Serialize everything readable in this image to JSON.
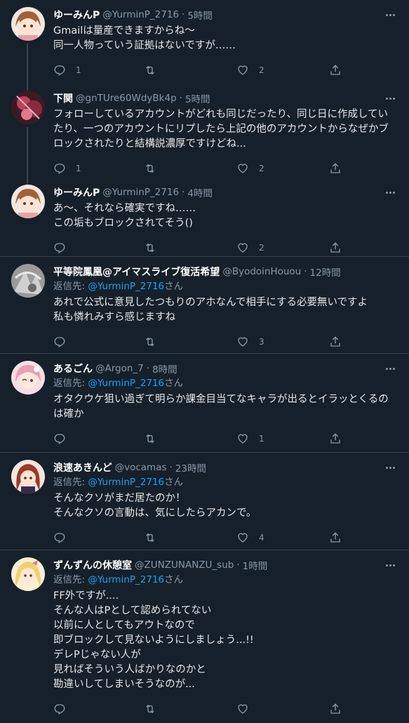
{
  "tweets": [
    {
      "name": "ゆーみんP",
      "handle": "@YurminP_2716",
      "time": "5時間",
      "replying_label": "",
      "replying_to": "",
      "replying_suffix": "",
      "lines": [
        "Gmailは量産できますからね〜",
        "同一人物っていう証拠はないですが……"
      ],
      "reply_count": "1",
      "retweet_count": "",
      "like_count": "2",
      "avatar": "anime-girl-brown-hair"
    },
    {
      "name": "下関",
      "handle": "@gnTUre60WdyBk4p",
      "time": "5時間",
      "replying_label": "",
      "replying_to": "",
      "replying_suffix": "",
      "lines": [
        "フォローしているアカウントがどれも同じだったり、同じ日に作成してい",
        "たり、一つのアカウントにリプしたら上記の他のアカウントからなぜかブ",
        "ロックされたりと結構説濃厚ですけどね..."
      ],
      "reply_count": "1",
      "retweet_count": "",
      "like_count": "2",
      "avatar": "dark-red-figure"
    },
    {
      "name": "ゆーみんP",
      "handle": "@YurminP_2716",
      "time": "4時間",
      "replying_label": "",
      "replying_to": "",
      "replying_suffix": "",
      "lines": [
        "あ〜、それなら確実ですね……",
        "この垢もブロックされてそう()"
      ],
      "reply_count": "",
      "retweet_count": "",
      "like_count": "2",
      "avatar": "anime-girl-brown-hair"
    },
    {
      "name": "平等院鳳凰@アイマスライブ復活希望",
      "handle": "@ByodoinHouou",
      "time": "12時間",
      "replying_label": "返信先:",
      "replying_to": "@YurminP_2716",
      "replying_suffix": "さん",
      "lines": [
        "あれで公式に意見したつもりのアホなんで相手にする必要無いですよ",
        "私も憐れみすら感じますね"
      ],
      "reply_count": "",
      "retweet_count": "",
      "like_count": "3",
      "avatar": "grey-sketch"
    },
    {
      "name": "あるごん",
      "handle": "@Argon_7",
      "time": "8時間",
      "replying_label": "返信先:",
      "replying_to": "@YurminP_2716",
      "replying_suffix": "さん",
      "lines": [
        "オタクウケ狙い過ぎて明らか課金目当てなキャラが出るとイラッとくるの",
        "は確か"
      ],
      "reply_count": "",
      "retweet_count": "",
      "like_count": "1",
      "avatar": "anime-girl-pink"
    },
    {
      "name": "浪速あきんど",
      "handle": "@vocamas",
      "time": "23時間",
      "replying_label": "返信先:",
      "replying_to": "@YurminP_2716",
      "replying_suffix": "さん",
      "lines": [
        "そんなクソがまだ居たのか！",
        "そんなクソの言動は、気にしたらアカンで。"
      ],
      "reply_count": "",
      "retweet_count": "",
      "like_count": "4",
      "avatar": "anime-girl-red-hair"
    },
    {
      "name": "ずんずんの休憩室",
      "handle": "@ZUNZUNANZU_sub",
      "time": "1時間",
      "replying_label": "返信先:",
      "replying_to": "@YurminP_2716",
      "replying_suffix": "さん",
      "lines": [
        "FF外ですが....",
        "そんな人はPとして認められてない",
        "以前に人としてもアウトなので",
        "即ブロックして見ないようにしましょう...!!",
        "デレPじゃない人が",
        "見ればそういう人ばかりなのかと",
        "勘違いしてしまいそうなのが..."
      ],
      "reply_count": "",
      "retweet_count": "",
      "like_count": "",
      "avatar": "anime-girl-blonde"
    }
  ],
  "icons": {
    "reply": "reply-icon",
    "retweet": "retweet-icon",
    "like": "heart-icon",
    "share": "share-icon",
    "more": "more-icon"
  },
  "colors": {
    "background": "#15202b",
    "accent": "#1da1f2",
    "secondary_text": "#8899a6",
    "divider": "#38444d"
  }
}
